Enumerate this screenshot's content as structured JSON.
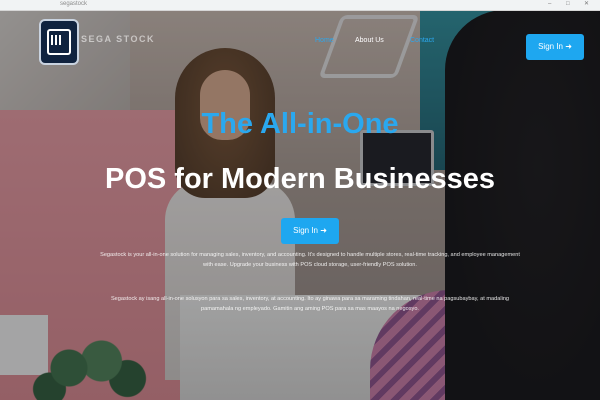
{
  "browser": {
    "url": "segastock",
    "controls": [
      "–",
      "□",
      "✕"
    ]
  },
  "header": {
    "logo_text": "SEGA STOCK",
    "nav": [
      "Home",
      "About Us",
      "Contact"
    ],
    "signin_label": "Sign In ➜"
  },
  "hero": {
    "title_line1": "The All-in-One",
    "title_line2": "POS for Modern Businesses",
    "signin_label": "Sign In ➜",
    "paragraph1": "Segastock is your all-in-one solution for managing sales, inventory, and accounting. It's designed to handle multiple stores, real-time tracking, and employee management with ease. Upgrade your business with POS cloud storage, user-friendly POS solution.",
    "paragraph2": "Segastock ay isang all-in-one solusyon para sa sales, inventory, at accounting. Ito ay ginawa para sa maraming tindahan, real-time na pagsubaybay, at madaling pamamahala ng empleyado. Gamitin ang aming POS para sa mas maayos na negosyo."
  },
  "colors": {
    "accent": "#1ea7f0",
    "accent_text": "#2aa8ef",
    "hero_white": "#ffffff"
  }
}
